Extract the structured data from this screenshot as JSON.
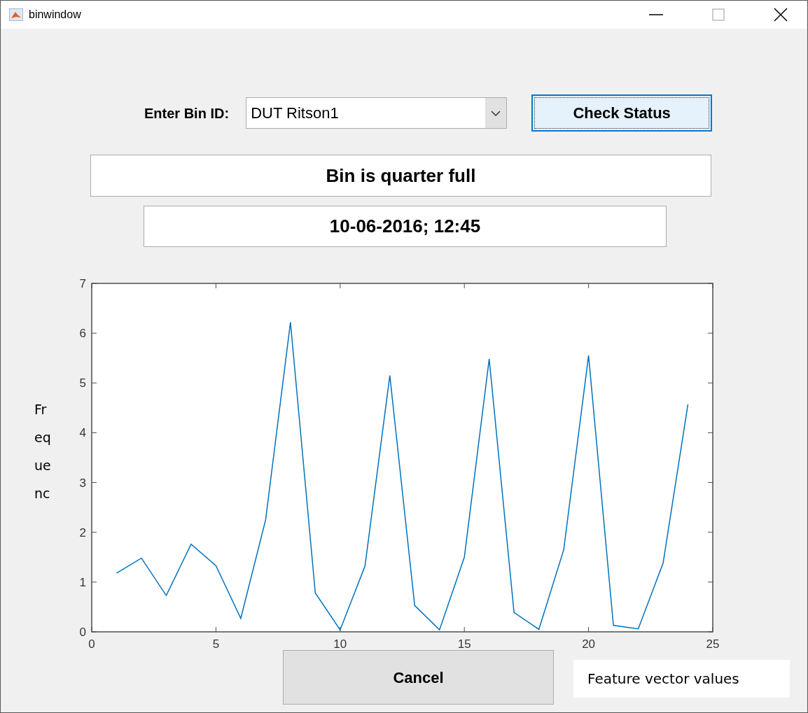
{
  "window": {
    "title": "binwindow"
  },
  "bin_id": {
    "label": "Enter Bin ID:",
    "value": "DUT Ritson1"
  },
  "check_button": "Check Status",
  "status": "Bin is quarter full",
  "timestamp": "10-06-2016; 12:45",
  "ylabel_fragment": [
    "Fr",
    "eq",
    "ue",
    "nc"
  ],
  "plot": {
    "chart_data": {
      "type": "line",
      "x": [
        1,
        2,
        3,
        4,
        5,
        6,
        7,
        8,
        9,
        10,
        11,
        12,
        13,
        14,
        15,
        16,
        17,
        18,
        19,
        20,
        21,
        22,
        23,
        24
      ],
      "series": [
        {
          "color": "#0072bd",
          "values": [
            1.18,
            1.48,
            0.73,
            1.76,
            1.33,
            0.27,
            2.25,
            6.22,
            0.78,
            0.04,
            1.32,
            5.15,
            0.53,
            0.04,
            1.5,
            5.48,
            0.39,
            0.05,
            1.65,
            5.55,
            0.13,
            0.06,
            1.38,
            4.57
          ]
        }
      ],
      "xlim": [
        0,
        25
      ],
      "ylim": [
        0,
        7
      ],
      "xticks": [
        0,
        5,
        10,
        15,
        20,
        25
      ],
      "yticks": [
        0,
        1,
        2,
        3,
        4,
        5,
        6,
        7
      ]
    }
  },
  "cancel_button": "Cancel",
  "caption": "Feature vector values"
}
